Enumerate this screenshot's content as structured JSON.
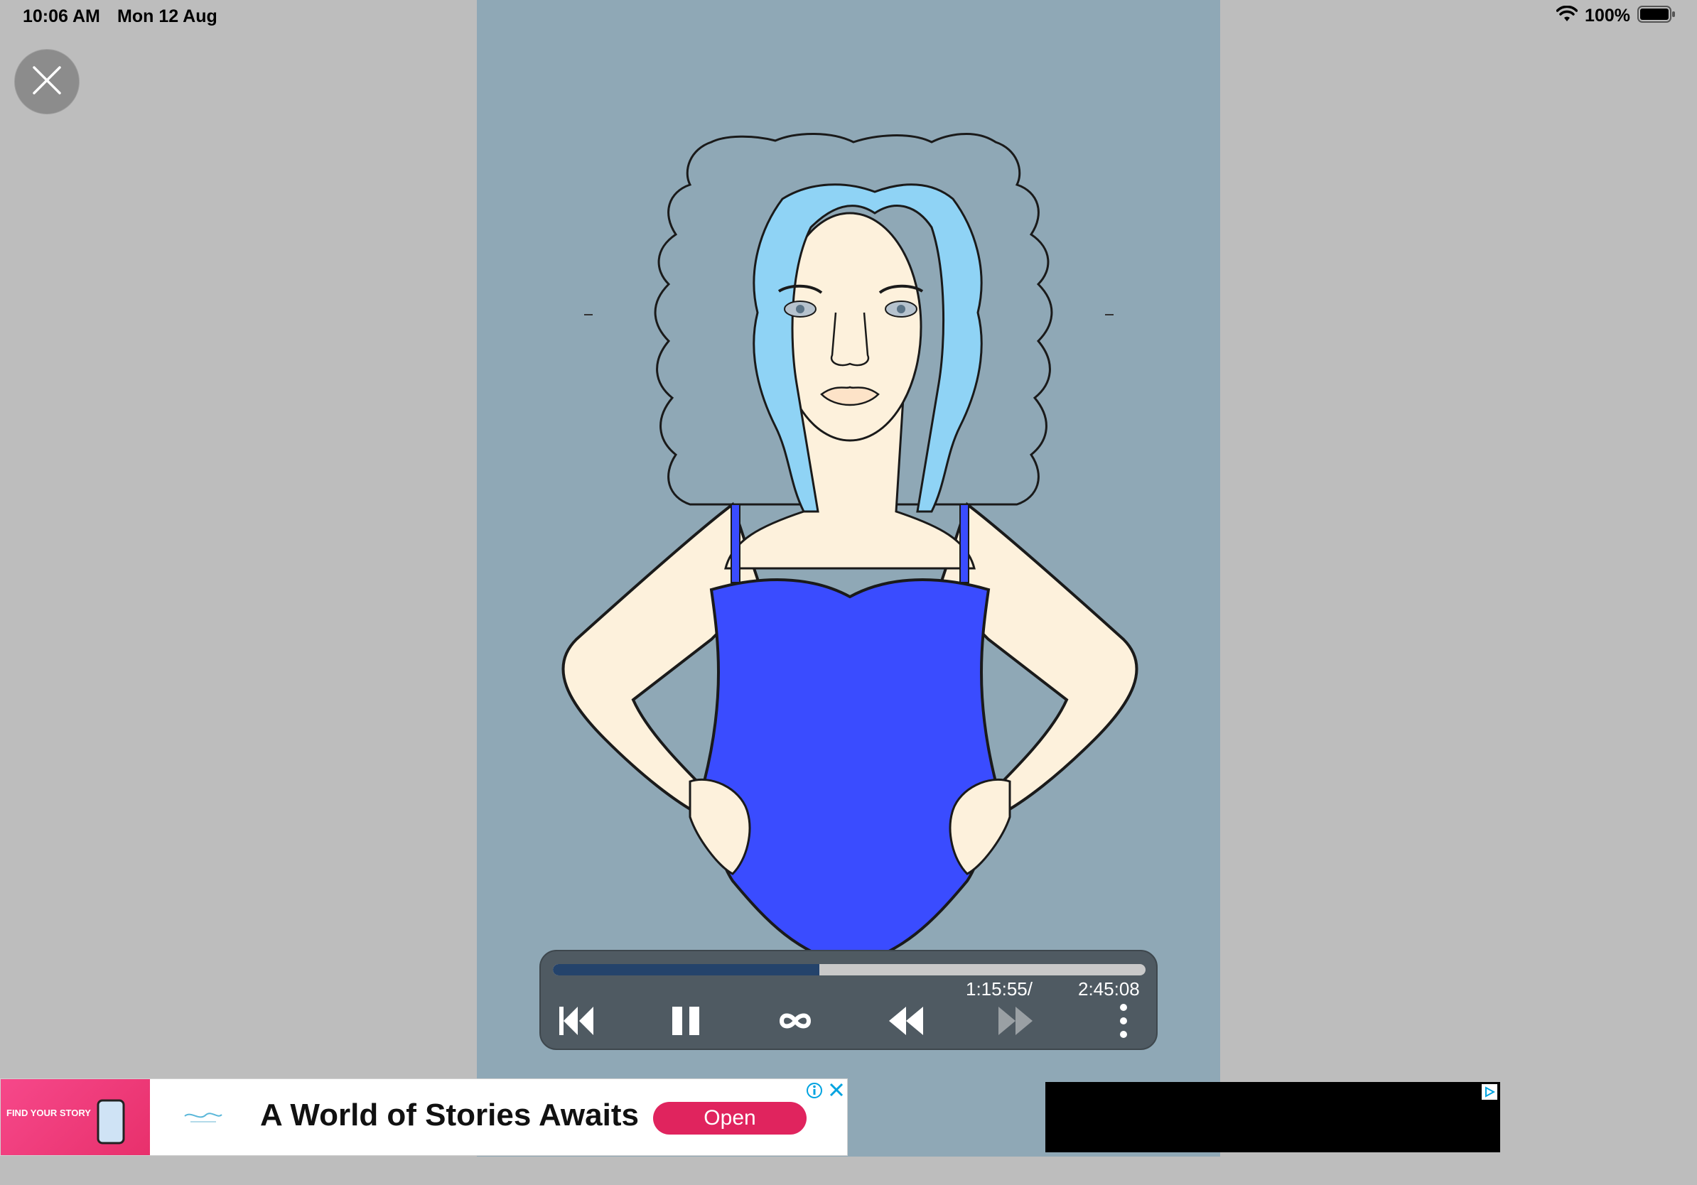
{
  "status_bar": {
    "time": "10:06 AM",
    "date": "Mon 12 Aug",
    "battery_percent": "100%",
    "icons": [
      "wifi-icon",
      "battery-icon"
    ]
  },
  "close_button": {
    "icon": "close-icon"
  },
  "player": {
    "current_time": "1:15:55/",
    "total_time": "2:45:08",
    "progress": 0.45,
    "controls": [
      "skip-to-start-icon",
      "pause-icon",
      "loop-icon",
      "rewind-icon",
      "fast-forward-icon",
      "more-vertical-icon"
    ]
  },
  "ad": {
    "thumb_text": "FIND YOUR STORY",
    "headline": "A World of Stories Awaits",
    "open_label": "Open",
    "icons": [
      "ad-info-icon",
      "ad-close-icon"
    ]
  },
  "colors": {
    "canvas_bg": "#8fa8b6",
    "player_bg": "#4f5a62",
    "progress_fill": "#24436b",
    "open_button": "#e0245e",
    "top_color": "#3a4cff",
    "hair_color": "#8fd3f5"
  }
}
